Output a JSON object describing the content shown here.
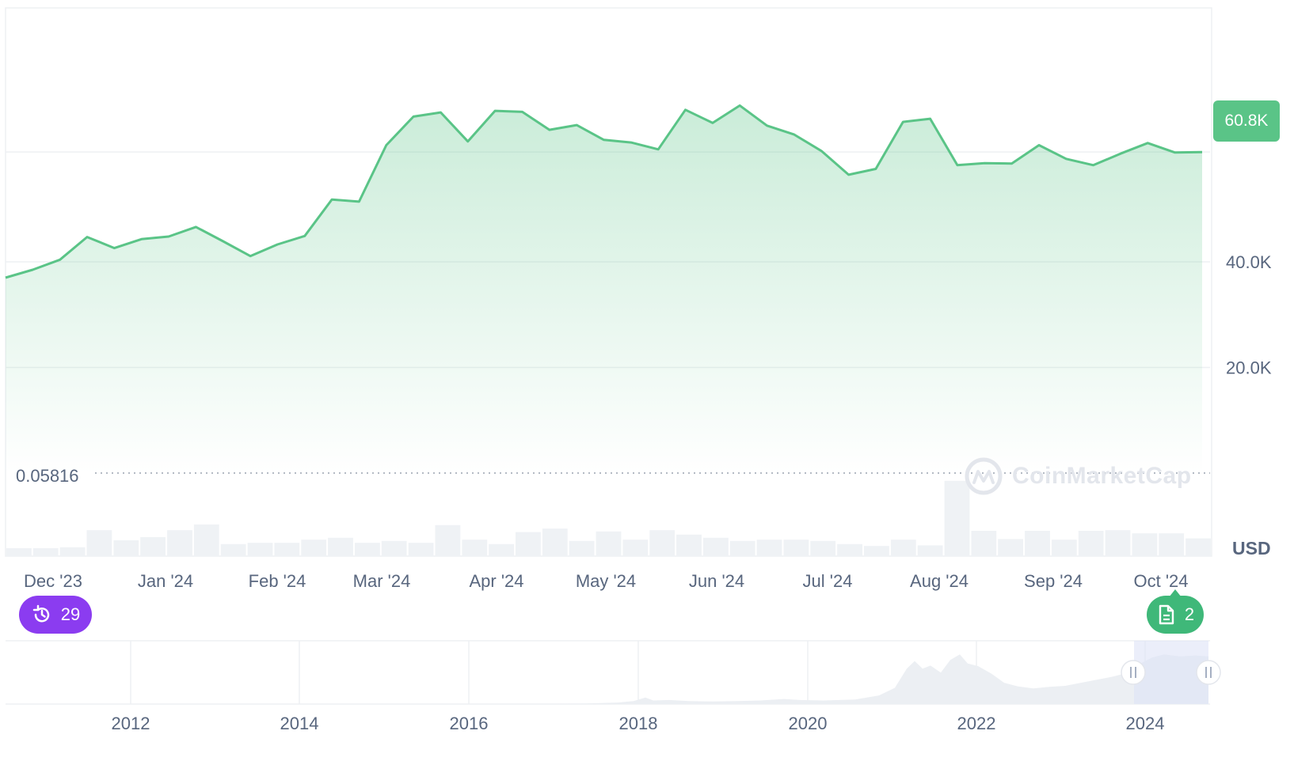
{
  "chart_data": {
    "type": "area",
    "currency": "USD",
    "last_value_label": "60.8K",
    "reference_value": "0.05816",
    "ylim": [
      0,
      80000
    ],
    "y_ticks": [
      "20.0K",
      "40.0K",
      "60.8K"
    ],
    "x_tick_labels": [
      "Dec '23",
      "Jan '24",
      "Feb '24",
      "Mar '24",
      "Apr '24",
      "May '24",
      "Jun '24",
      "Jul '24",
      "Aug '24",
      "Sep '24",
      "Oct '24"
    ],
    "price": [
      37000,
      38500,
      40400,
      44700,
      42600,
      44300,
      44800,
      46600,
      43900,
      41100,
      43300,
      44900,
      51800,
      51400,
      62100,
      67500,
      68300,
      62800,
      68600,
      68400,
      65000,
      65900,
      63100,
      62600,
      61300,
      68800,
      66300,
      69600,
      65800,
      64100,
      61000,
      56500,
      57600,
      66500,
      67100,
      58300,
      58700,
      58600,
      62100,
      59500,
      58300,
      60500,
      62500,
      60700,
      60800
    ],
    "volume": [
      25,
      25,
      28,
      82,
      50,
      60,
      82,
      100,
      38,
      42,
      42,
      52,
      58,
      42,
      48,
      42,
      98,
      52,
      38,
      76,
      87,
      48,
      78,
      52,
      82,
      68,
      58,
      48,
      52,
      52,
      48,
      38,
      32,
      52,
      34,
      238,
      80,
      54,
      80,
      52,
      80,
      82,
      72,
      72,
      56
    ],
    "navigator": {
      "x_tick_labels": [
        "2012",
        "2014",
        "2016",
        "2018",
        "2020",
        "2022",
        "2024"
      ],
      "range_start": "2024",
      "range_end": "Oct '24"
    }
  },
  "badges": {
    "history_count": "29",
    "notes_count": "2"
  },
  "watermark": "CoinMarketCap",
  "colors": {
    "line": "#5ac487",
    "tag": "#5ac487",
    "history_badge": "#8b3cf0",
    "notes_badge": "#3fb879",
    "volume": "#eff2f5",
    "navigator_fill": "#eceff3",
    "selection": "#dde3f6"
  }
}
